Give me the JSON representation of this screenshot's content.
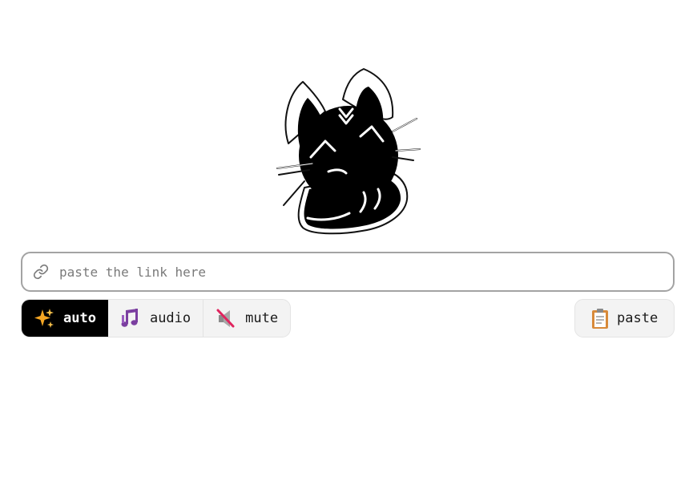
{
  "mascot": {
    "icon": "cat-mascot-icon"
  },
  "link_input": {
    "placeholder": "paste the link here",
    "value": "",
    "icon": "link-icon"
  },
  "mode_switcher": {
    "items": [
      {
        "label": "auto",
        "icon": "sparkles-icon",
        "active": true
      },
      {
        "label": "audio",
        "icon": "music-notes-icon",
        "active": false
      },
      {
        "label": "mute",
        "icon": "muted-speaker-icon",
        "active": false
      }
    ]
  },
  "paste_button": {
    "label": "paste",
    "icon": "clipboard-icon"
  },
  "colors": {
    "active_bg": "#000000",
    "button_bg": "#f3f3f3",
    "input_border": "#a3a3a3",
    "sparkle": "#f5a623",
    "music": "#7b3fa0",
    "mute_slash": "#e0245e"
  }
}
